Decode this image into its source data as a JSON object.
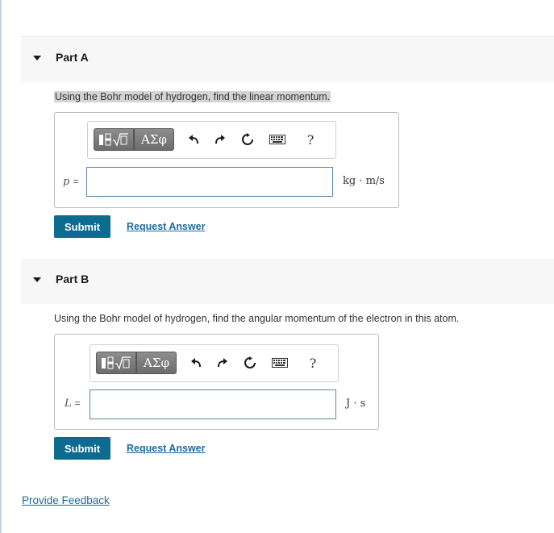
{
  "toolbar": {
    "templates_icon": "fraction-sqrt-templates-icon",
    "greek_label": "ΑΣφ",
    "undo_icon": "undo-icon",
    "redo_icon": "redo-icon",
    "reset_icon": "reset-icon",
    "keyboard_icon": "keyboard-icon",
    "help_label": "?"
  },
  "part_a": {
    "title": "Part A",
    "question": "Using the Bohr model of hydrogen, find the linear momentum.",
    "variable": "p",
    "equals": "=",
    "input_value": "",
    "units": "kg · m/s",
    "submit_label": "Submit",
    "request_label": "Request Answer"
  },
  "part_b": {
    "title": "Part B",
    "question": "Using the Bohr model of hydrogen, find the angular momentum of the electron in this atom.",
    "variable": "L",
    "equals": "=",
    "input_value": "",
    "units": "J · s",
    "submit_label": "Submit",
    "request_label": "Request Answer"
  },
  "feedback_label": "Provide Feedback",
  "colors": {
    "accent": "#0e6b90",
    "link": "#1d6a9c",
    "header_bg": "#f7f7f7",
    "input_border": "#5e86a6"
  }
}
